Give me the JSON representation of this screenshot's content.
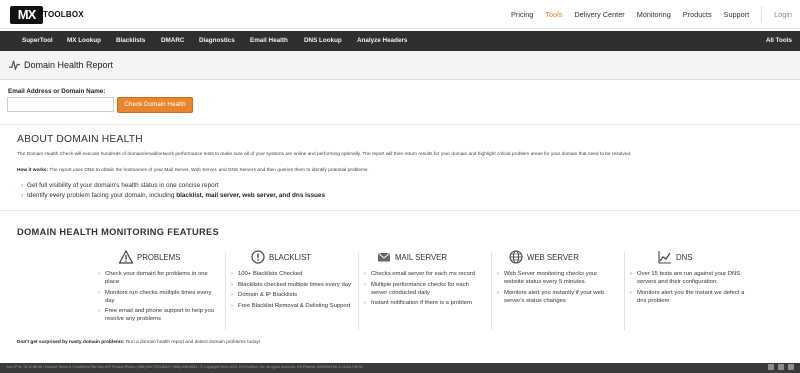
{
  "brand": {
    "logo_mx": "MX",
    "logo_text": "TOOLBOX"
  },
  "top_nav": {
    "items": [
      "Pricing",
      "Tools",
      "Delivery Center",
      "Monitoring",
      "Products",
      "Support"
    ],
    "active": "Tools",
    "login": "Login",
    "accent_color": "#e67e22"
  },
  "main_nav": {
    "items": [
      "SuperTool",
      "MX Lookup",
      "Blacklists",
      "DMARC",
      "Diagnostics",
      "Email Health",
      "DNS Lookup",
      "Analyze Headers"
    ],
    "right": "All Tools"
  },
  "page": {
    "title": "Domain Health Report",
    "icon": "health-pulse-icon"
  },
  "form": {
    "label": "Email Address or Domain Name:",
    "input_value": "",
    "input_placeholder": "",
    "button": "Check Domain Health",
    "button_color": "#e8862e"
  },
  "about": {
    "heading": "ABOUT DOMAIN HEALTH",
    "paragraph": "The Domain Health Check will execute hundreds of domain/email/network performance tests to make sure all of your systems are online and performing optimally. The report will then return results for your domain and highlight critical problem areas for your domain that need to be resolved.",
    "how_label": "How it works:",
    "how_text": " The report uses DNS to obtain the hostnames of your Mail Server, Web Server, and DNS Servers and then queries them to identify potential problems.",
    "bullet1": "Get full visibility of your domain's health status in one concise report",
    "bullet2_pre": "Identify every problem facing your domain, including ",
    "bullet2_bold": "blacklist, mail server, web server, and dns issues"
  },
  "features": {
    "heading": "DOMAIN HEALTH MONITORING FEATURES",
    "columns": [
      {
        "name": "PROBLEMS",
        "icon": "warning-icon",
        "items": [
          "Check your domain for problems in one place",
          "Monitors run checks multiple times every day",
          "Free email and phone support to help you resolve any problems"
        ]
      },
      {
        "name": "BLACKLIST",
        "icon": "blacklist-alert-icon",
        "items": [
          "100+ Blacklists Checked",
          "Blacklists checked multiple times every day",
          "Domain & IP Blacklists",
          "Free Blacklist Removal & Delisting Support"
        ]
      },
      {
        "name": "MAIL SERVER",
        "icon": "envelope-icon",
        "items": [
          "Checks email server for each mx record",
          "Multiple performance checks for each server conducted daily",
          "Instant notification if there is a problem"
        ]
      },
      {
        "name": "WEB SERVER",
        "icon": "globe-icon",
        "items": [
          "Web Server monitoring checks your website status every 5 minutes.",
          "Monitors alert you instantly if your web server's status changes"
        ]
      },
      {
        "name": "DNS",
        "icon": "chart-icon",
        "items": [
          "Over 15 tests are run against your DNS servers and their configuration.",
          "Monitors alert you the instant we defect a dns problem"
        ]
      }
    ]
  },
  "surprise": {
    "bold": "Don't get surprised by nasty domain problems:",
    "text": " Run a domain health report and detect domain problems today!"
  },
  "footer": {
    "text": "Your IP is: 76.11.88.99 | Contact Terms & Conditions Site Map API Privacy Phone: (866)-MXTOOLBOX / (866)-698-6652 | © Copyright 2004-2021, MXToolBox, Inc. All rights reserved. US Patents 10608963 B2 & 11461738 B2"
  }
}
